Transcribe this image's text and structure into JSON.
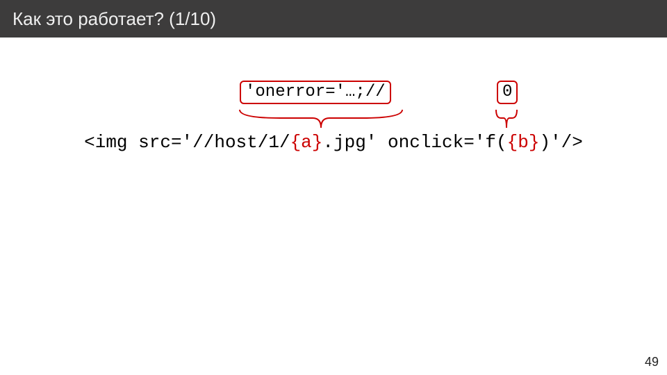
{
  "header": {
    "title": "Как это работает? (1/10)"
  },
  "badges": {
    "a": "'onerror='…;//",
    "b": "0"
  },
  "code": {
    "p1": "<img src='//host/1/",
    "a": "{a}",
    "p2": ".jpg' onclick='f(",
    "b": "{b}",
    "p3": ")'/>"
  },
  "page_number": "49"
}
